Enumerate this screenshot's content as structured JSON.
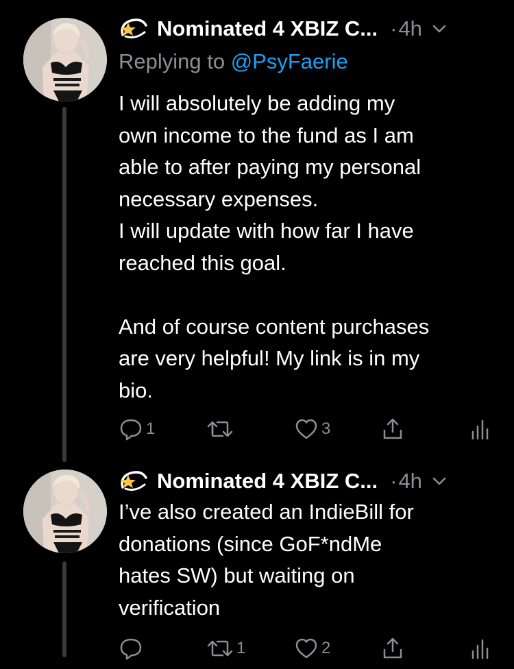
{
  "tweets": [
    {
      "display_name": "Nominated 4 XBIZ C...",
      "time": "4h",
      "time_dot": "·",
      "replying_prefix": "Replying to",
      "replying_handle": "@PsyFaerie",
      "text": "I will absolutely be adding my\nown income to the fund as I am\nable to after paying my personal\nnecessary expenses.\nI will update with how far I have\nreached this goal.\n\nAnd of course content purchases\nare very helpful! My link is in my\nbio.",
      "reply_count": "1",
      "retweet_count": "",
      "like_count": "3"
    },
    {
      "display_name": "Nominated 4 XBIZ C...",
      "time": "4h",
      "time_dot": "·",
      "text": "I’ve also created an IndieBill for\ndonations (since GoF*ndMe\nhates SW) but waiting on\nverification",
      "reply_count": "",
      "retweet_count": "1",
      "like_count": "2"
    }
  ],
  "colors": {
    "background": "#000000",
    "text": "#ffffff",
    "secondary": "#8e8e93",
    "link": "#1da1f2",
    "thread_line": "#3a3a3c"
  }
}
